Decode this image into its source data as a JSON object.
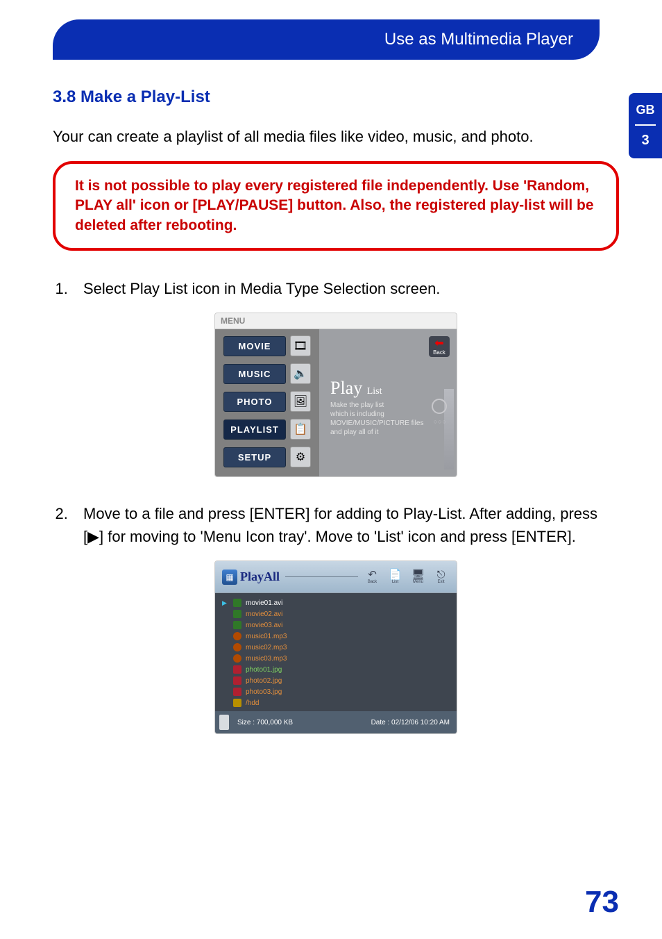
{
  "banner": {
    "title": "Use as Multimedia Player"
  },
  "side_tab": {
    "lang": "GB",
    "chapter": "3"
  },
  "section": {
    "title": "3.8 Make a Play-List"
  },
  "intro": "Your can create a playlist of all media files like video, music, and photo.",
  "warning": "It is not possible to play every registered file independently. Use 'Random, PLAY all' icon or [PLAY/PAUSE] button. Also, the registered play-list will be deleted after rebooting.",
  "steps": {
    "s1": "Select Play List icon in Media Type Selection screen.",
    "s2": "Move to a file and press [ENTER] for adding to Play-List. After adding, press [▶] for moving to 'Menu Icon tray'. Move to 'List' icon and press [ENTER]."
  },
  "screenshot1": {
    "header": "MENU",
    "items": {
      "movie": "MOVIE",
      "music": "MUSIC",
      "photo": "PHOTO",
      "playlist": "PLAYLIST",
      "setup": "SETUP"
    },
    "back_label": "Back",
    "title_main": "Play",
    "title_sub": "List",
    "desc_l1": "Make the play list",
    "desc_l2": "which is including",
    "desc_l3": "MOVIE/MUSIC/PICTURE files",
    "desc_l4": "and play all of it"
  },
  "screenshot2": {
    "title": "PlayAll",
    "toolbar": {
      "back": "Back",
      "list": "List",
      "menu": "Menu",
      "exit": "Exit"
    },
    "files": {
      "f0": "movie01.avi",
      "f1": "movie02.avi",
      "f2": "movie03.avi",
      "f3": "music01.mp3",
      "f4": "music02.mp3",
      "f5": "music03.mp3",
      "f6": "photo01.jpg",
      "f7": "photo02.jpg",
      "f8": "photo03.jpg",
      "f9": "/hdd"
    },
    "status": {
      "size": "Size : 700,000 KB",
      "date": "Date : 02/12/06  10:20  AM"
    }
  },
  "page_number": "73"
}
